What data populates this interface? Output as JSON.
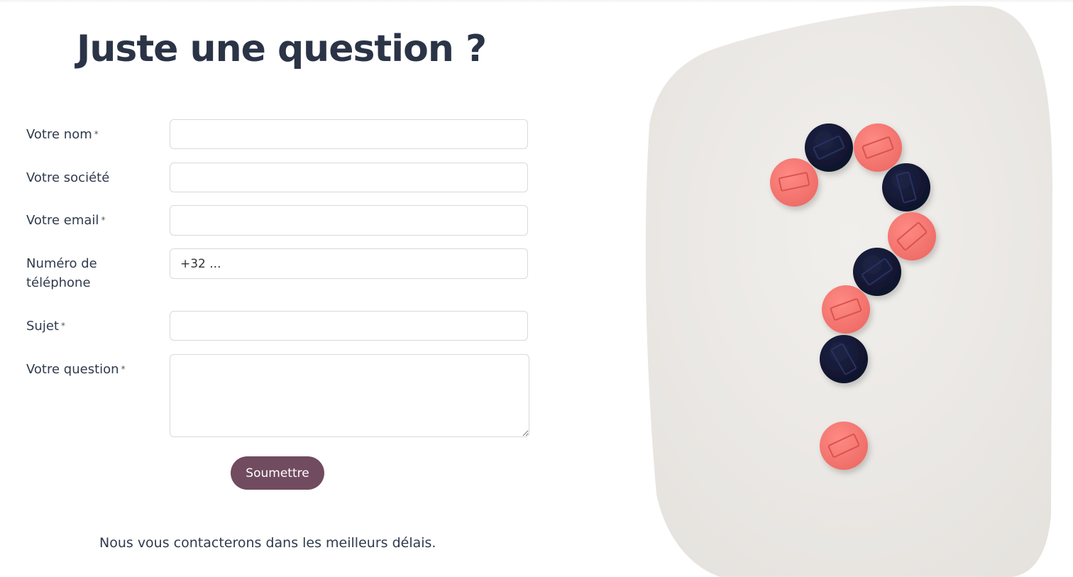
{
  "header": {
    "title": "Juste une question ?"
  },
  "form": {
    "required_mark": "*",
    "fields": [
      {
        "label": "Votre nom",
        "required": true,
        "value": "",
        "placeholder": ""
      },
      {
        "label": "Votre société",
        "required": false,
        "value": "",
        "placeholder": ""
      },
      {
        "label": "Votre email",
        "required": true,
        "value": "",
        "placeholder": ""
      },
      {
        "label": "Numéro de téléphone",
        "required": false,
        "value": "",
        "placeholder": "+32 ..."
      },
      {
        "label": "Sujet",
        "required": true,
        "value": "",
        "placeholder": ""
      },
      {
        "label": "Votre question",
        "required": true,
        "value": "",
        "placeholder": ""
      }
    ],
    "submit_label": "Soumettre",
    "submit_color": "#714b5f"
  },
  "footer": {
    "note": "Nous vous contacterons dans les meilleurs délais."
  },
  "image": {
    "subject": "question-mark-made-of-magnets",
    "background_color": "#edeae6",
    "magnet_colors": [
      "#f47771",
      "#141a38"
    ]
  }
}
